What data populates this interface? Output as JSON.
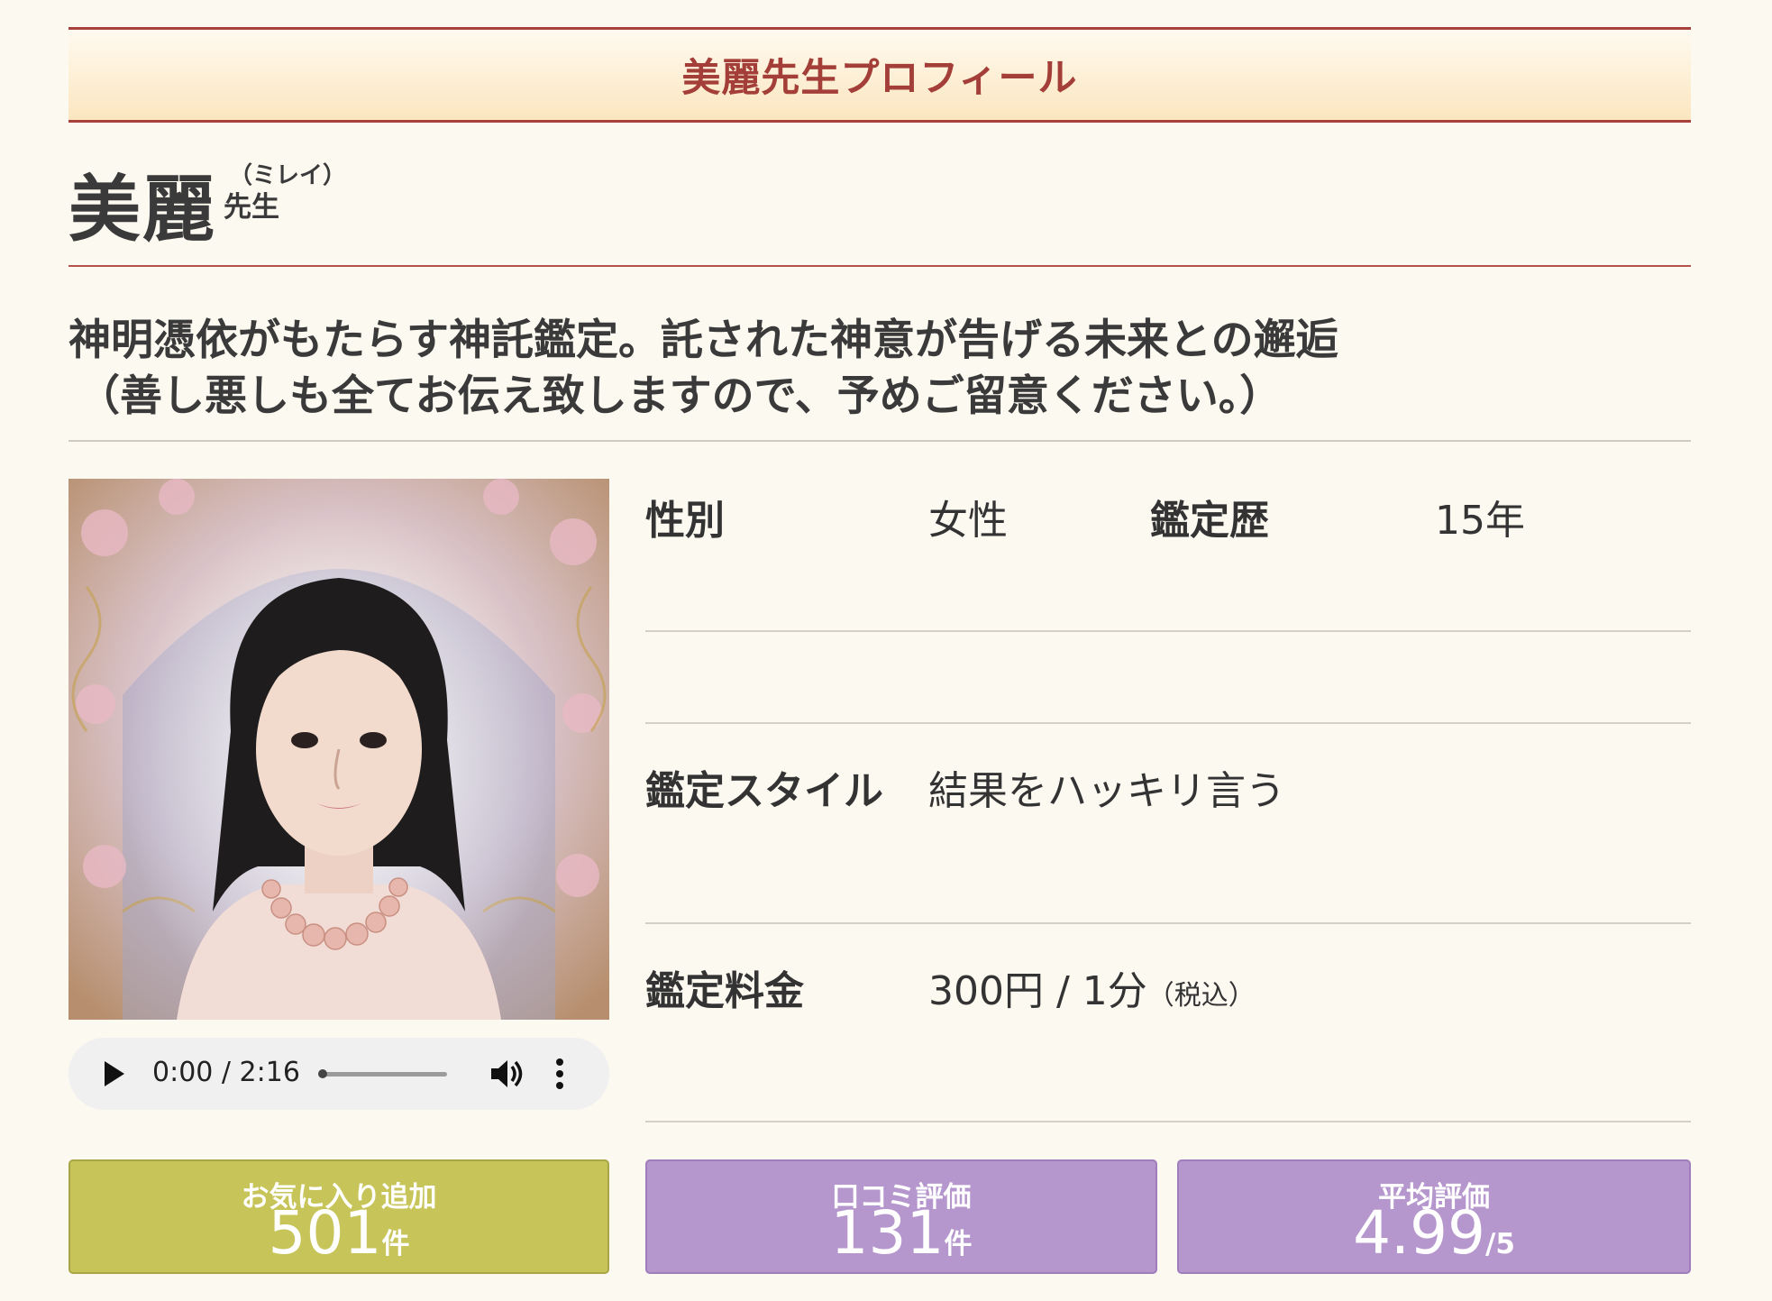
{
  "header": {
    "title": "美麗先生プロフィール"
  },
  "profile": {
    "name": "美麗",
    "kana": "（ミレイ）",
    "suffix": "先生",
    "catch_line1": "神明憑依がもたらす神託鑑定。託された神意が告げる未来との邂逅",
    "catch_line2": "（善し悪しも全てお伝え致しますので、予めご留意ください。）"
  },
  "audio": {
    "time": "0:00 / 2:16",
    "progress": 0
  },
  "details": {
    "gender_label": "性別",
    "gender_value": "女性",
    "career_label": "鑑定歴",
    "career_value": "15年",
    "style_label": "鑑定スタイル",
    "style_value": "結果をハッキリ言う",
    "fee_label": "鑑定料金",
    "fee_value": "300円 / 1分",
    "fee_tax": "（税込）"
  },
  "stats": {
    "favorites": {
      "label": "お気に入り追加",
      "value": "501",
      "unit": "件"
    },
    "reviews": {
      "label": "口コミ評価",
      "value": "131",
      "unit": "件"
    },
    "average": {
      "label": "平均評価",
      "value": "4.99",
      "unit": "/5"
    }
  },
  "colors": {
    "accent_red": "#a33f38",
    "fav_green": "#c7c45a",
    "review_purple": "#b596cd"
  }
}
